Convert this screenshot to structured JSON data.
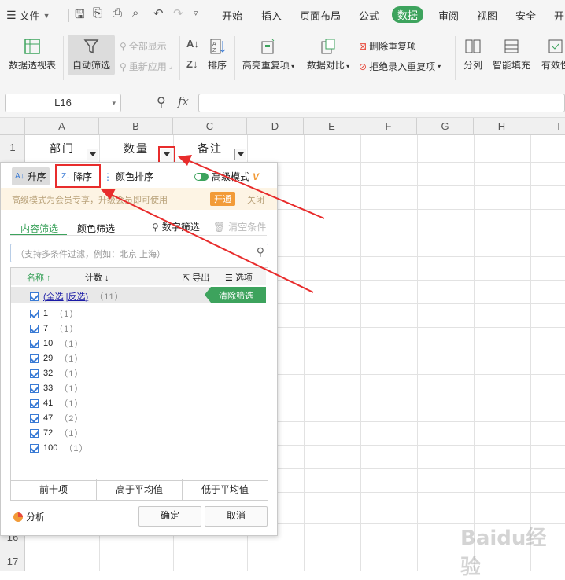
{
  "menubar": {
    "file": "文件",
    "tabs": [
      "开始",
      "插入",
      "页面布局",
      "公式",
      "数据",
      "审阅",
      "视图",
      "安全",
      "开"
    ],
    "active_tab": "数据"
  },
  "toolbar": {
    "pivot": "数据透视表",
    "autofilter": "自动筛选",
    "show_all": "全部显示",
    "reapply": "重新应用",
    "sort": "排序",
    "highlight_dup": "高亮重复项",
    "compare": "数据对比",
    "remove_dup": "删除重复项",
    "reject_dup": "拒绝录入重复项",
    "split": "分列",
    "smart_fill": "智能填充",
    "validity": "有效性"
  },
  "formula": {
    "cell_ref": "L16",
    "fx": "fx"
  },
  "columns": [
    "A",
    "B",
    "C",
    "D",
    "E",
    "F",
    "G",
    "H",
    "I"
  ],
  "rows": [
    "1",
    "16",
    "17"
  ],
  "header_cells": {
    "a": "部门",
    "b": "数量",
    "c": "备注"
  },
  "popup": {
    "asc": "升序",
    "desc": "降序",
    "color_sort": "颜色排序",
    "adv_mode": "高级模式",
    "vip_text": "高级模式为会员专享，升级会员即可使用",
    "open": "开通",
    "close": "关闭",
    "tab_content": "内容筛选",
    "tab_color": "颜色筛选",
    "number_filter": "数字筛选",
    "clear_cond": "清空条件",
    "search_placeholder": "（支持多条件过滤，例如：北京  上海）",
    "col_name": "名称",
    "col_count": "计数",
    "export": "导出",
    "options": "选项",
    "select_all": "全选",
    "invert": "反选",
    "select_all_count": "（11）",
    "clear_filter": "清除筛选",
    "items": [
      {
        "label": "1",
        "count": "（1）"
      },
      {
        "label": "7",
        "count": "（1）"
      },
      {
        "label": "10",
        "count": "（1）"
      },
      {
        "label": "29",
        "count": "（1）"
      },
      {
        "label": "32",
        "count": "（1）"
      },
      {
        "label": "33",
        "count": "（1）"
      },
      {
        "label": "41",
        "count": "（1）"
      },
      {
        "label": "47",
        "count": "（2）"
      },
      {
        "label": "72",
        "count": "（1）"
      },
      {
        "label": "100",
        "count": "（1）"
      }
    ],
    "top10": "前十项",
    "above_avg": "高于平均值",
    "below_avg": "低于平均值",
    "analyze": "分析",
    "ok": "确定",
    "cancel": "取消"
  },
  "watermark": "Baidu经验",
  "colors": {
    "accent_green": "#3da35d",
    "highlight_red": "#e82c2c",
    "vip_orange": "#f29b38"
  }
}
